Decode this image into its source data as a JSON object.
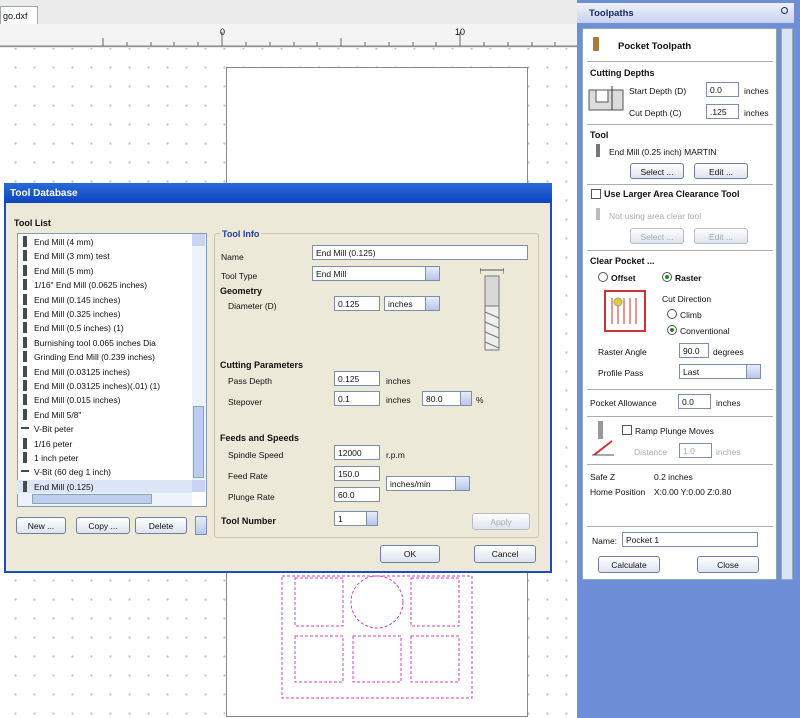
{
  "canvas": {
    "tab_label": "go.dxf",
    "ruler_ticks": [
      "0",
      "10"
    ]
  },
  "panel": {
    "title": "Toolpaths",
    "pin_icon": "pin-icon",
    "toolpath_name": "Pocket Toolpath",
    "cutting_depths": {
      "heading": "Cutting Depths",
      "start_label": "Start Depth (D)",
      "start_value": "0.0",
      "start_unit": "inches",
      "cut_label": "Cut Depth (C)",
      "cut_value": ".125",
      "cut_unit": "inches"
    },
    "tool": {
      "heading": "Tool",
      "name": "End Mill (0.25 inch) MARTIN",
      "select_label": "Select ...",
      "edit_label": "Edit ..."
    },
    "larger_area": {
      "label": "Use Larger Area Clearance Tool",
      "status": "Not using area clear tool",
      "select_label": "Select ...",
      "edit_label": "Edit ..."
    },
    "clear_pocket": {
      "heading": "Clear Pocket ...",
      "offset_label": "Offset",
      "raster_label": "Raster",
      "cut_direction_label": "Cut Direction",
      "climb_label": "Climb",
      "conventional_label": "Conventional",
      "raster_angle_label": "Raster Angle",
      "raster_angle_value": "90.0",
      "raster_angle_unit": "degrees",
      "profile_pass_label": "Profile Pass",
      "profile_pass_value": "Last"
    },
    "pocket_allowance": {
      "label": "Pocket Allowance",
      "value": "0.0",
      "unit": "inches"
    },
    "ramp": {
      "label": "Ramp Plunge Moves",
      "distance_label": "Distance",
      "distance_value": "1.0",
      "distance_unit": "inches"
    },
    "safe_z_label": "Safe Z",
    "safe_z_value": "0.2 inches",
    "home_label": "Home Position",
    "home_value": "X:0.00 Y:0.00 Z:0.80",
    "name_label": "Name:",
    "name_value": "Pocket 1",
    "calculate_label": "Calculate",
    "close_label": "Close"
  },
  "dialog": {
    "title": "Tool Database",
    "tool_list_heading": "Tool List",
    "tools": [
      "End Mill (4 mm)",
      "End Mill (3 mm) test",
      "End Mill (5 mm)",
      "1/16\" End Mill (0.0625 inches)",
      "End Mill (0.145 inches)",
      "End Mill (0.325 inches)",
      "End Mill (0.5 inches) (1)",
      "Burnishing tool 0.065 inches Dia",
      "Grinding End Mill (0.239 inches)",
      "End Mill (0.03125 inches)",
      "End Mill (0.03125 inches)(.01) (1)",
      "End Mill (0.015 inches)",
      "End Mill 5/8\"",
      "V-Bit peter",
      "1/16 peter",
      "1 inch peter",
      "V-Bit (60 deg 1 inch)",
      "End Mill (0.125)"
    ],
    "selected_index": 17,
    "new_label": "New ...",
    "copy_label": "Copy ...",
    "delete_label": "Delete",
    "info_heading": "Tool Info",
    "name_label": "Name",
    "name_value": "End Mill (0.125)",
    "tool_type_label": "Tool Type",
    "tool_type_value": "End Mill",
    "geometry_heading": "Geometry",
    "diameter_label": "Diameter (D)",
    "diameter_value": "0.125",
    "diameter_unit": "inches",
    "cutting_heading": "Cutting Parameters",
    "pass_depth_label": "Pass Depth",
    "pass_depth_value": "0.125",
    "pass_depth_unit": "inches",
    "stepover_label": "Stepover",
    "stepover_value": "0.1",
    "stepover_unit": "inches",
    "stepover_pct": "80.0",
    "pct_sign": "%",
    "feeds_heading": "Feeds and Speeds",
    "spindle_label": "Spindle Speed",
    "spindle_value": "12000",
    "spindle_unit": "r.p.m",
    "feed_label": "Feed Rate",
    "feed_value": "150.0",
    "plunge_label": "Plunge Rate",
    "plunge_value": "60.0",
    "rate_unit": "inches/min",
    "tool_number_label": "Tool Number",
    "tool_number_value": "1",
    "apply_label": "Apply",
    "ok_label": "OK",
    "cancel_label": "Cancel"
  }
}
